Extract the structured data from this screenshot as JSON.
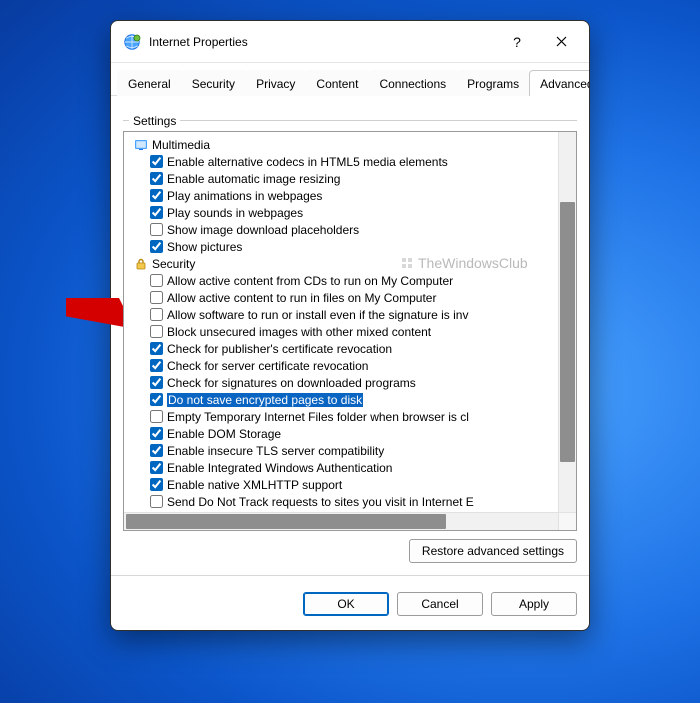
{
  "window": {
    "title": "Internet Properties"
  },
  "tabs": [
    "General",
    "Security",
    "Privacy",
    "Content",
    "Connections",
    "Programs",
    "Advanced"
  ],
  "activeTabIndex": 6,
  "settings_label": "Settings",
  "watermark": "TheWindowsClub",
  "restore_label": "Restore advanced settings",
  "buttons": {
    "ok": "OK",
    "cancel": "Cancel",
    "apply": "Apply"
  },
  "selected_item_label": "Do not save encrypted pages to disk",
  "tree": [
    {
      "type": "cat",
      "icon": "multimedia",
      "label": "Multimedia"
    },
    {
      "type": "item",
      "checked": true,
      "label": "Enable alternative codecs in HTML5 media elements"
    },
    {
      "type": "item",
      "checked": true,
      "label": "Enable automatic image resizing"
    },
    {
      "type": "item",
      "checked": true,
      "label": "Play animations in webpages"
    },
    {
      "type": "item",
      "checked": true,
      "label": "Play sounds in webpages"
    },
    {
      "type": "item",
      "checked": false,
      "label": "Show image download placeholders"
    },
    {
      "type": "item",
      "checked": true,
      "label": "Show pictures"
    },
    {
      "type": "cat",
      "icon": "security",
      "label": "Security"
    },
    {
      "type": "item",
      "checked": false,
      "label": "Allow active content from CDs to run on My Computer"
    },
    {
      "type": "item",
      "checked": false,
      "label": "Allow active content to run in files on My Computer"
    },
    {
      "type": "item",
      "checked": false,
      "label": "Allow software to run or install even if the signature is inv"
    },
    {
      "type": "item",
      "checked": false,
      "label": "Block unsecured images with other mixed content"
    },
    {
      "type": "item",
      "checked": true,
      "label": "Check for publisher's certificate revocation"
    },
    {
      "type": "item",
      "checked": true,
      "label": "Check for server certificate revocation"
    },
    {
      "type": "item",
      "checked": true,
      "label": "Check for signatures on downloaded programs"
    },
    {
      "type": "item",
      "checked": true,
      "selected": true,
      "label": "Do not save encrypted pages to disk"
    },
    {
      "type": "item",
      "checked": false,
      "label": "Empty Temporary Internet Files folder when browser is cl"
    },
    {
      "type": "item",
      "checked": true,
      "label": "Enable DOM Storage"
    },
    {
      "type": "item",
      "checked": true,
      "label": "Enable insecure TLS server compatibility"
    },
    {
      "type": "item",
      "checked": true,
      "label": "Enable Integrated Windows Authentication"
    },
    {
      "type": "item",
      "checked": true,
      "label": "Enable native XMLHTTP support"
    },
    {
      "type": "item",
      "checked": false,
      "label": "Send Do Not Track requests to sites you visit in Internet E"
    }
  ]
}
